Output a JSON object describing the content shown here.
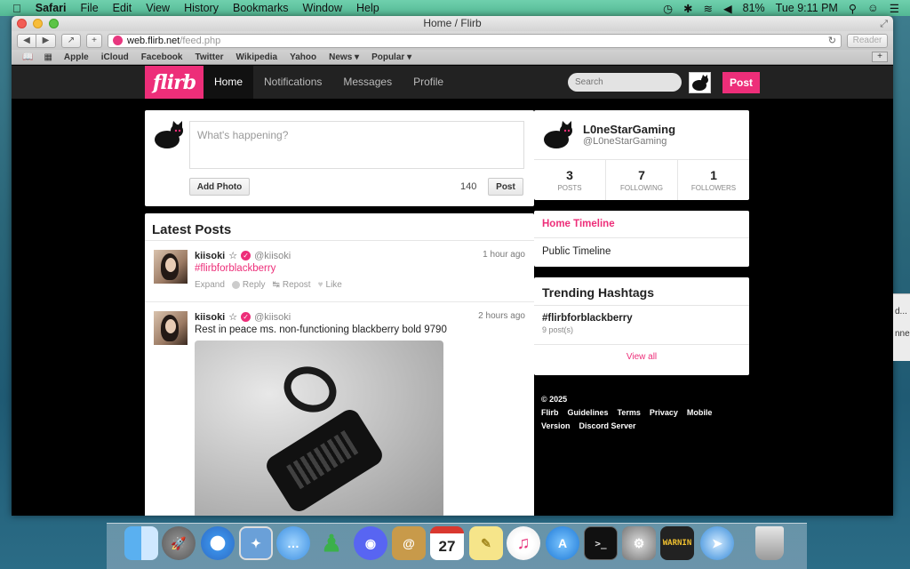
{
  "menubar": {
    "app": "Safari",
    "items": [
      "File",
      "Edit",
      "View",
      "History",
      "Bookmarks",
      "Window",
      "Help"
    ],
    "battery": "81%",
    "clock": "Tue 9:11 PM"
  },
  "window": {
    "title": "Home / Flirb",
    "url_host": "web.flirb.net",
    "url_path": "/feed.php",
    "reader": "Reader"
  },
  "bookmarks": [
    "Apple",
    "iCloud",
    "Facebook",
    "Twitter",
    "Wikipedia",
    "Yahoo",
    "News ▾",
    "Popular ▾"
  ],
  "site": {
    "logo": "flirb",
    "nav": [
      "Home",
      "Notifications",
      "Messages",
      "Profile"
    ],
    "search_placeholder": "Search",
    "post_button": "Post"
  },
  "compose": {
    "placeholder": "What's happening?",
    "add_photo": "Add Photo",
    "char_count": "140",
    "post": "Post"
  },
  "latest": {
    "title": "Latest Posts",
    "posts": [
      {
        "user": "kiisoki",
        "star": "☆",
        "handle": "@kiisoki",
        "time": "1 hour ago",
        "text": "#flirbforblackberry",
        "expand": "Expand",
        "reply": "Reply",
        "repost": "Repost",
        "like": "Like"
      },
      {
        "user": "kiisoki",
        "star": "☆",
        "handle": "@kiisoki",
        "time": "2 hours ago",
        "text": "Rest in peace ms. non-functioning blackberry bold 9790"
      }
    ]
  },
  "profile": {
    "name": "L0neStarGaming",
    "handle": "@L0neStarGaming",
    "stats": [
      {
        "num": "3",
        "label": "POSTS"
      },
      {
        "num": "7",
        "label": "FOLLOWING"
      },
      {
        "num": "1",
        "label": "FOLLOWERS"
      }
    ]
  },
  "timelines": {
    "home": "Home Timeline",
    "public": "Public Timeline"
  },
  "trending": {
    "title": "Trending Hashtags",
    "tag": "#flirbforblackberry",
    "count": "9 post(s)",
    "view_all": "View all"
  },
  "footer": {
    "copyright": "© 2025 Flirb",
    "links": [
      "Guidelines",
      "Terms",
      "Privacy",
      "Mobile Version",
      "Discord Server"
    ]
  },
  "bg_window": {
    "line1": "d...",
    "line2": "nne"
  },
  "calendar_day": "27",
  "console_text": "WARNIN",
  "colors": {
    "brand": "#ed2e79",
    "menubar": "#5fc49f",
    "site_bg": "#000000"
  }
}
